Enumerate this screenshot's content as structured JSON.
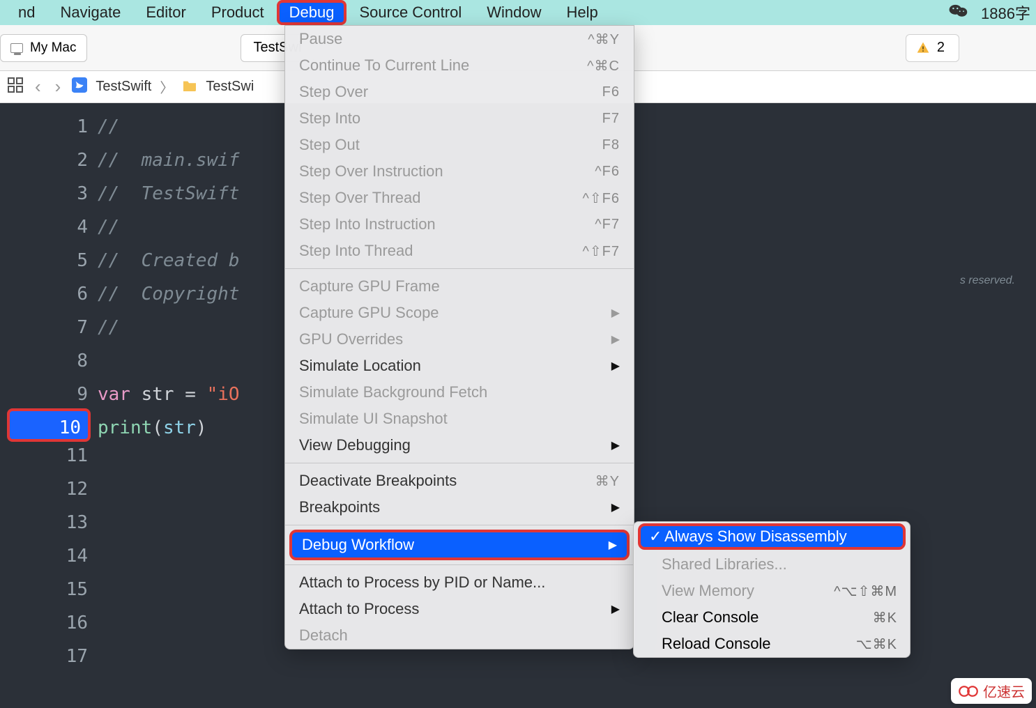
{
  "menubar": {
    "items": [
      "nd",
      "Navigate",
      "Editor",
      "Product",
      "Debug",
      "Source Control",
      "Window",
      "Help"
    ],
    "highlighted_index": 4,
    "right_text": "1886字"
  },
  "toolbar": {
    "scheme_label": "My Mac",
    "tab_label": "TestSwi",
    "warning_count": "2"
  },
  "breadcrumb": {
    "project": "TestSwift",
    "folder": "TestSwi"
  },
  "editor": {
    "lines": [
      {
        "n": "1",
        "html": "<span class='c-comment'>//</span>"
      },
      {
        "n": "2",
        "html": "<span class='c-comment'>//  main.swif</span>"
      },
      {
        "n": "3",
        "html": "<span class='c-comment'>//  TestSwift</span>"
      },
      {
        "n": "4",
        "html": "<span class='c-comment'>//</span>"
      },
      {
        "n": "5",
        "html": "<span class='c-comment'>//  Created b</span>"
      },
      {
        "n": "6",
        "html": "<span class='c-comment'>//  Copyright</span>"
      },
      {
        "n": "7",
        "html": "<span class='c-comment'>//</span>"
      },
      {
        "n": "8",
        "html": ""
      },
      {
        "n": "9",
        "html": "<span class='c-key'>var</span> <span class='c-ident'>str</span> = <span class='c-str'>\"iO</span>"
      },
      {
        "n": "10",
        "bp": true,
        "html": "<span class='c-func'>print</span>(<span class='c-type'>str</span>)"
      },
      {
        "n": "11",
        "html": ""
      },
      {
        "n": "12",
        "html": ""
      },
      {
        "n": "13",
        "html": ""
      },
      {
        "n": "14",
        "html": ""
      },
      {
        "n": "15",
        "html": ""
      },
      {
        "n": "16",
        "html": ""
      },
      {
        "n": "17",
        "html": ""
      }
    ],
    "right_tail_text": "s reserved."
  },
  "debug_menu": [
    {
      "label": "Pause",
      "shortcut": "^⌘Y",
      "disabled": true
    },
    {
      "label": "Continue To Current Line",
      "shortcut": "^⌘C",
      "disabled": true
    },
    {
      "label": "Step Over",
      "shortcut": "F6",
      "disabled": true
    },
    {
      "label": "Step Into",
      "shortcut": "F7",
      "disabled": true
    },
    {
      "label": "Step Out",
      "shortcut": "F8",
      "disabled": true
    },
    {
      "label": "Step Over Instruction",
      "shortcut": "^F6",
      "disabled": true
    },
    {
      "label": "Step Over Thread",
      "shortcut": "^⇧F6",
      "disabled": true
    },
    {
      "label": "Step Into Instruction",
      "shortcut": "^F7",
      "disabled": true
    },
    {
      "label": "Step Into Thread",
      "shortcut": "^⇧F7",
      "disabled": true
    },
    {
      "sep": true
    },
    {
      "label": "Capture GPU Frame",
      "disabled": true
    },
    {
      "label": "Capture GPU Scope",
      "submenu": true,
      "disabled": true
    },
    {
      "label": "GPU Overrides",
      "submenu": true,
      "disabled": true
    },
    {
      "label": "Simulate Location",
      "submenu": true
    },
    {
      "label": "Simulate Background Fetch",
      "disabled": true
    },
    {
      "label": "Simulate UI Snapshot",
      "disabled": true
    },
    {
      "label": "View Debugging",
      "submenu": true
    },
    {
      "sep": true
    },
    {
      "label": "Deactivate Breakpoints",
      "shortcut": "⌘Y"
    },
    {
      "label": "Breakpoints",
      "submenu": true
    },
    {
      "sep": true
    },
    {
      "label": "Debug Workflow",
      "submenu": true,
      "selected": true,
      "framed": true
    },
    {
      "sep": true
    },
    {
      "label": "Attach to Process by PID or Name..."
    },
    {
      "label": "Attach to Process",
      "submenu": true
    },
    {
      "label": "Detach",
      "disabled": true
    }
  ],
  "submenu": [
    {
      "label": "Always Show Disassembly",
      "checked": true,
      "selected": true,
      "framed": true
    },
    {
      "label": "Shared Libraries...",
      "disabled": true
    },
    {
      "label": "View Memory",
      "shortcut": "^⌥⇧⌘M",
      "disabled": true
    },
    {
      "label": "Clear Console",
      "shortcut": "⌘K"
    },
    {
      "label": "Reload Console",
      "shortcut": "⌥⌘K"
    }
  ],
  "watermark": "亿速云"
}
